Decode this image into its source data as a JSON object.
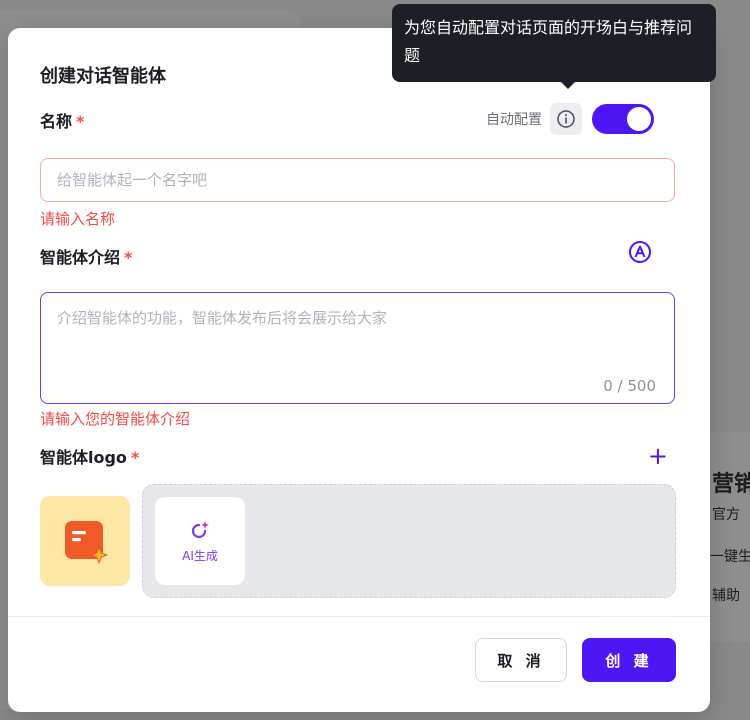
{
  "background": {
    "snippets": [
      "营销",
      "官方",
      "一键生",
      "辅助"
    ]
  },
  "modal": {
    "title": "创建对话智能体",
    "name_field": {
      "label": "名称",
      "required_mark": "*",
      "auto_config_label": "自动配置",
      "toggle_on": true,
      "placeholder": "给智能体起一个名字吧",
      "error": "请输入名称"
    },
    "intro_field": {
      "label": "智能体介绍",
      "required_mark": "*",
      "placeholder": "介绍智能体的功能，智能体发布后将会展示给大家",
      "counter": "0 / 500",
      "error": "请输入您的智能体介绍"
    },
    "logo_field": {
      "label": "智能体logo",
      "required_mark": "*",
      "ai_generate_label": "AI生成"
    },
    "buttons": {
      "cancel": "取 消",
      "create": "创 建"
    }
  },
  "tooltip": {
    "text": "为您自动配置对话页面的开场白与推荐问题"
  },
  "colors": {
    "accent": "#4f16f5",
    "error": "#f54a45",
    "tooltip_bg": "#1d1f26"
  }
}
